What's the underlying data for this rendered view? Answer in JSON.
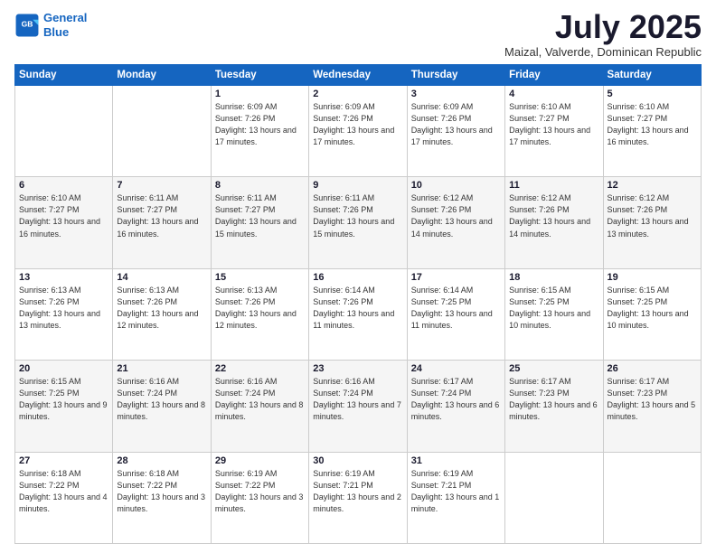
{
  "logo": {
    "line1": "General",
    "line2": "Blue"
  },
  "title": "July 2025",
  "subtitle": "Maizal, Valverde, Dominican Republic",
  "days_of_week": [
    "Sunday",
    "Monday",
    "Tuesday",
    "Wednesday",
    "Thursday",
    "Friday",
    "Saturday"
  ],
  "weeks": [
    [
      {
        "num": "",
        "info": ""
      },
      {
        "num": "",
        "info": ""
      },
      {
        "num": "1",
        "info": "Sunrise: 6:09 AM\nSunset: 7:26 PM\nDaylight: 13 hours and 17 minutes."
      },
      {
        "num": "2",
        "info": "Sunrise: 6:09 AM\nSunset: 7:26 PM\nDaylight: 13 hours and 17 minutes."
      },
      {
        "num": "3",
        "info": "Sunrise: 6:09 AM\nSunset: 7:26 PM\nDaylight: 13 hours and 17 minutes."
      },
      {
        "num": "4",
        "info": "Sunrise: 6:10 AM\nSunset: 7:27 PM\nDaylight: 13 hours and 17 minutes."
      },
      {
        "num": "5",
        "info": "Sunrise: 6:10 AM\nSunset: 7:27 PM\nDaylight: 13 hours and 16 minutes."
      }
    ],
    [
      {
        "num": "6",
        "info": "Sunrise: 6:10 AM\nSunset: 7:27 PM\nDaylight: 13 hours and 16 minutes."
      },
      {
        "num": "7",
        "info": "Sunrise: 6:11 AM\nSunset: 7:27 PM\nDaylight: 13 hours and 16 minutes."
      },
      {
        "num": "8",
        "info": "Sunrise: 6:11 AM\nSunset: 7:27 PM\nDaylight: 13 hours and 15 minutes."
      },
      {
        "num": "9",
        "info": "Sunrise: 6:11 AM\nSunset: 7:26 PM\nDaylight: 13 hours and 15 minutes."
      },
      {
        "num": "10",
        "info": "Sunrise: 6:12 AM\nSunset: 7:26 PM\nDaylight: 13 hours and 14 minutes."
      },
      {
        "num": "11",
        "info": "Sunrise: 6:12 AM\nSunset: 7:26 PM\nDaylight: 13 hours and 14 minutes."
      },
      {
        "num": "12",
        "info": "Sunrise: 6:12 AM\nSunset: 7:26 PM\nDaylight: 13 hours and 13 minutes."
      }
    ],
    [
      {
        "num": "13",
        "info": "Sunrise: 6:13 AM\nSunset: 7:26 PM\nDaylight: 13 hours and 13 minutes."
      },
      {
        "num": "14",
        "info": "Sunrise: 6:13 AM\nSunset: 7:26 PM\nDaylight: 13 hours and 12 minutes."
      },
      {
        "num": "15",
        "info": "Sunrise: 6:13 AM\nSunset: 7:26 PM\nDaylight: 13 hours and 12 minutes."
      },
      {
        "num": "16",
        "info": "Sunrise: 6:14 AM\nSunset: 7:26 PM\nDaylight: 13 hours and 11 minutes."
      },
      {
        "num": "17",
        "info": "Sunrise: 6:14 AM\nSunset: 7:25 PM\nDaylight: 13 hours and 11 minutes."
      },
      {
        "num": "18",
        "info": "Sunrise: 6:15 AM\nSunset: 7:25 PM\nDaylight: 13 hours and 10 minutes."
      },
      {
        "num": "19",
        "info": "Sunrise: 6:15 AM\nSunset: 7:25 PM\nDaylight: 13 hours and 10 minutes."
      }
    ],
    [
      {
        "num": "20",
        "info": "Sunrise: 6:15 AM\nSunset: 7:25 PM\nDaylight: 13 hours and 9 minutes."
      },
      {
        "num": "21",
        "info": "Sunrise: 6:16 AM\nSunset: 7:24 PM\nDaylight: 13 hours and 8 minutes."
      },
      {
        "num": "22",
        "info": "Sunrise: 6:16 AM\nSunset: 7:24 PM\nDaylight: 13 hours and 8 minutes."
      },
      {
        "num": "23",
        "info": "Sunrise: 6:16 AM\nSunset: 7:24 PM\nDaylight: 13 hours and 7 minutes."
      },
      {
        "num": "24",
        "info": "Sunrise: 6:17 AM\nSunset: 7:24 PM\nDaylight: 13 hours and 6 minutes."
      },
      {
        "num": "25",
        "info": "Sunrise: 6:17 AM\nSunset: 7:23 PM\nDaylight: 13 hours and 6 minutes."
      },
      {
        "num": "26",
        "info": "Sunrise: 6:17 AM\nSunset: 7:23 PM\nDaylight: 13 hours and 5 minutes."
      }
    ],
    [
      {
        "num": "27",
        "info": "Sunrise: 6:18 AM\nSunset: 7:22 PM\nDaylight: 13 hours and 4 minutes."
      },
      {
        "num": "28",
        "info": "Sunrise: 6:18 AM\nSunset: 7:22 PM\nDaylight: 13 hours and 3 minutes."
      },
      {
        "num": "29",
        "info": "Sunrise: 6:19 AM\nSunset: 7:22 PM\nDaylight: 13 hours and 3 minutes."
      },
      {
        "num": "30",
        "info": "Sunrise: 6:19 AM\nSunset: 7:21 PM\nDaylight: 13 hours and 2 minutes."
      },
      {
        "num": "31",
        "info": "Sunrise: 6:19 AM\nSunset: 7:21 PM\nDaylight: 13 hours and 1 minute."
      },
      {
        "num": "",
        "info": ""
      },
      {
        "num": "",
        "info": ""
      }
    ]
  ]
}
